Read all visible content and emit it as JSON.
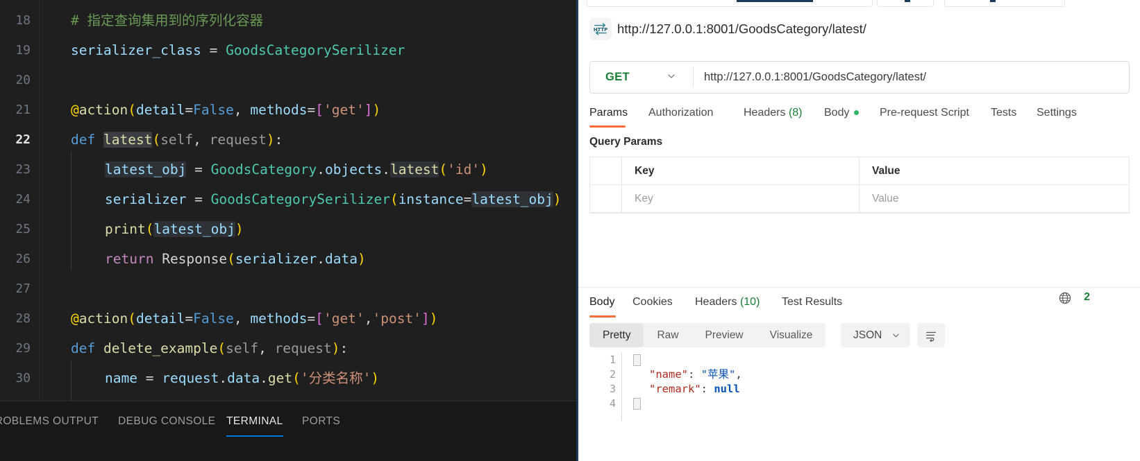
{
  "editor": {
    "line_numbers": [
      "18",
      "19",
      "20",
      "21",
      "22",
      "23",
      "24",
      "25",
      "26",
      "27",
      "28",
      "29",
      "30"
    ],
    "active_line": "22",
    "lines": [
      {
        "n": "18",
        "text": "    # 指定查询集用到的序列化容器"
      },
      {
        "n": "19",
        "text": "    serializer_class = GoodsCategorySerilizer"
      },
      {
        "n": "20",
        "text": ""
      },
      {
        "n": "21",
        "text": "    @action(detail=False, methods=['get'])"
      },
      {
        "n": "22",
        "text": "    def latest(self, request):"
      },
      {
        "n": "23",
        "text": "        latest_obj = GoodsCategory.objects.latest('id')"
      },
      {
        "n": "24",
        "text": "        serializer = GoodsCategorySerilizer(instance=latest_obj)"
      },
      {
        "n": "25",
        "text": "        print(latest_obj)"
      },
      {
        "n": "26",
        "text": "        return Response(serializer.data)"
      },
      {
        "n": "27",
        "text": ""
      },
      {
        "n": "28",
        "text": "    @action(detail=False, methods=['get','post'])"
      },
      {
        "n": "29",
        "text": "    def delete_example(self, request):"
      },
      {
        "n": "30",
        "text": "        name = request.data.get('分类名称')"
      }
    ],
    "tokens": {
      "comment_18": "# 指定查询集用到的序列化容器",
      "var_serializer_class": "serializer_class",
      "eq": "=",
      "class_GoodsCategorySerilizer": "GoodsCategorySerilizer",
      "decorator_at": "@",
      "fn_action": "action",
      "param_detail": "detail",
      "kw_False": "False",
      "param_methods": "methods",
      "str_get": "'get'",
      "str_post": "'post'",
      "kw_def": "def",
      "fn_latest": "latest",
      "param_self": "self",
      "param_request": "request",
      "var_latest_obj": "latest_obj",
      "class_GoodsCategory": "GoodsCategory",
      "attr_objects": "objects",
      "attr_latest": "latest",
      "str_id": "'id'",
      "var_serializer": "serializer",
      "param_instance": "instance",
      "fn_print": "print",
      "kw_return": "return",
      "class_Response": "Response",
      "attr_data": "data",
      "fn_delete_example": "delete_example",
      "var_name": "name",
      "attr_get": "get",
      "str_fenlei": "'分类名称'"
    }
  },
  "panel_tabs": [
    {
      "label": "PROBLEMS",
      "active": false
    },
    {
      "label": "OUTPUT",
      "active": false
    },
    {
      "label": "DEBUG CONSOLE",
      "active": false
    },
    {
      "label": "TERMINAL",
      "active": true
    },
    {
      "label": "PORTS",
      "active": false
    }
  ],
  "postman": {
    "request_title": "http://127.0.0.1:8001/GoodsCategory/latest/",
    "http_icon_label": "HTTP",
    "method": "GET",
    "url_value": "http://127.0.0.1:8001/GoodsCategory/latest/",
    "request_tabs": [
      {
        "label": "Params",
        "active": true,
        "suffix": ""
      },
      {
        "label": "Authorization",
        "active": false,
        "suffix": ""
      },
      {
        "label": "Headers",
        "active": false,
        "suffix": "(8)"
      },
      {
        "label": "Body",
        "active": false,
        "suffix": "",
        "dot": true
      },
      {
        "label": "Pre-request Script",
        "active": false,
        "suffix": ""
      },
      {
        "label": "Tests",
        "active": false,
        "suffix": ""
      },
      {
        "label": "Settings",
        "active": false,
        "suffix": ""
      }
    ],
    "query_params_label": "Query Params",
    "params_table": {
      "headers": {
        "key": "Key",
        "value": "Value"
      },
      "rows": [
        {
          "key_placeholder": "Key",
          "value_placeholder": "Value"
        }
      ]
    },
    "response_tabs": [
      {
        "label": "Body",
        "active": true,
        "suffix": ""
      },
      {
        "label": "Cookies",
        "active": false,
        "suffix": ""
      },
      {
        "label": "Headers",
        "active": false,
        "suffix": "(10)"
      },
      {
        "label": "Test Results",
        "active": false,
        "suffix": ""
      }
    ],
    "status_code": "2",
    "format_buttons": [
      {
        "label": "Pretty",
        "active": true
      },
      {
        "label": "Raw",
        "active": false
      },
      {
        "label": "Preview",
        "active": false
      },
      {
        "label": "Visualize",
        "active": false
      }
    ],
    "language": "JSON",
    "json_body": {
      "line_numbers": [
        "1",
        "2",
        "3",
        "4"
      ],
      "lines": [
        {
          "n": "1",
          "kind": "open"
        },
        {
          "n": "2",
          "kind": "pair",
          "key": "\"name\"",
          "colon": ": ",
          "value": "\"苹果\"",
          "value_type": "string",
          "trailing": ","
        },
        {
          "n": "3",
          "kind": "pair",
          "key": "\"remark\"",
          "colon": ": ",
          "value": "null",
          "value_type": "null",
          "trailing": ""
        },
        {
          "n": "4",
          "kind": "close"
        }
      ]
    }
  },
  "colors": {
    "accent_orange": "#ff6c37",
    "vscode_blue": "#0078d4",
    "green": "#1a7f37",
    "editor_bg": "#1f1f1f"
  }
}
